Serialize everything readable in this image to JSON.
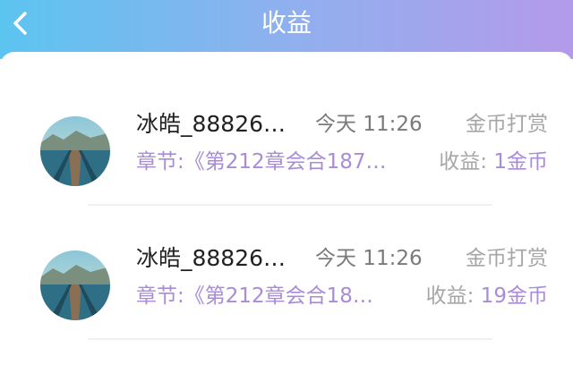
{
  "header": {
    "title": "收益",
    "back_icon": "chevron-left-icon"
  },
  "colors": {
    "header_gradient": [
      "#5cc4f0",
      "#8fb0ee",
      "#b49aea"
    ],
    "accent": "#a98bd8",
    "muted": "#a6a6a6"
  },
  "records": [
    {
      "name": "冰皓_88826…",
      "time": "今天 11:26",
      "type": "金币打赏",
      "chapter": "章节:《第212章会合187…",
      "income_label": "收益: ",
      "income_value": "1金币"
    },
    {
      "name": "冰皓_88826…",
      "time": "今天 11:26",
      "type": "金币打赏",
      "chapter": "章节:《第212章会合18…",
      "income_label": "收益: ",
      "income_value": "19金币"
    }
  ]
}
